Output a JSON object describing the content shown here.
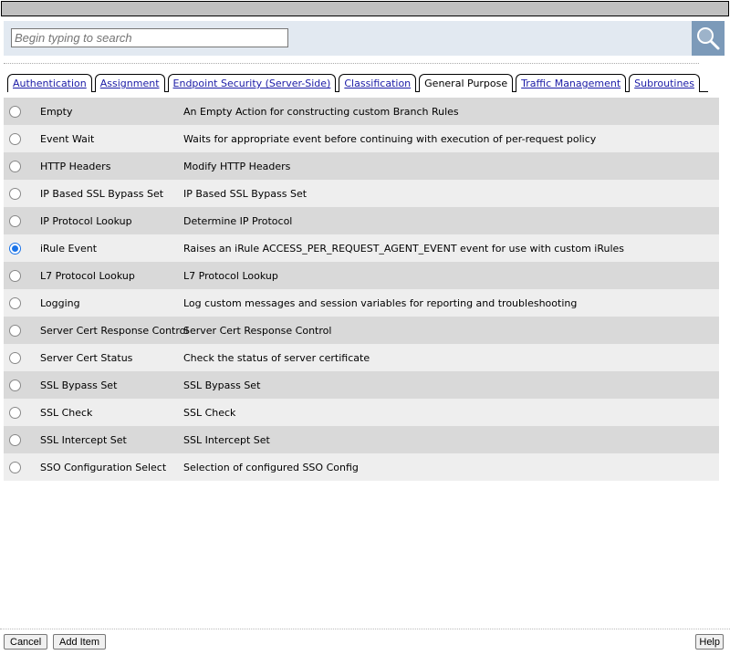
{
  "search": {
    "placeholder": "Begin typing to search"
  },
  "tabs": [
    {
      "label": "Authentication",
      "active": false
    },
    {
      "label": "Assignment",
      "active": false
    },
    {
      "label": "Endpoint Security (Server-Side)",
      "active": false
    },
    {
      "label": "Classification",
      "active": false
    },
    {
      "label": "General Purpose",
      "active": true
    },
    {
      "label": "Traffic Management",
      "active": false
    },
    {
      "label": "Subroutines",
      "active": false
    }
  ],
  "items": [
    {
      "name": "Empty",
      "desc": "An Empty Action for constructing custom Branch Rules",
      "selected": false
    },
    {
      "name": "Event Wait",
      "desc": "Waits for appropriate event before continuing with execution of per-request policy",
      "selected": false
    },
    {
      "name": "HTTP Headers",
      "desc": "Modify HTTP Headers",
      "selected": false
    },
    {
      "name": "IP Based SSL Bypass Set",
      "desc": "IP Based SSL Bypass Set",
      "selected": false
    },
    {
      "name": "IP Protocol Lookup",
      "desc": "Determine IP Protocol",
      "selected": false
    },
    {
      "name": "iRule Event",
      "desc": "Raises an iRule ACCESS_PER_REQUEST_AGENT_EVENT event for use with custom iRules",
      "selected": true
    },
    {
      "name": "L7 Protocol Lookup",
      "desc": "L7 Protocol Lookup",
      "selected": false
    },
    {
      "name": "Logging",
      "desc": "Log custom messages and session variables for reporting and troubleshooting",
      "selected": false
    },
    {
      "name": "Server Cert Response Control",
      "desc": "Server Cert Response Control",
      "selected": false
    },
    {
      "name": "Server Cert Status",
      "desc": "Check the status of server certificate",
      "selected": false
    },
    {
      "name": "SSL Bypass Set",
      "desc": "SSL Bypass Set",
      "selected": false
    },
    {
      "name": "SSL Check",
      "desc": "SSL Check",
      "selected": false
    },
    {
      "name": "SSL Intercept Set",
      "desc": "SSL Intercept Set",
      "selected": false
    },
    {
      "name": "SSO Configuration Select",
      "desc": "Selection of configured SSO Config",
      "selected": false
    }
  ],
  "buttons": {
    "cancel": "Cancel",
    "add": "Add Item",
    "help": "Help"
  }
}
